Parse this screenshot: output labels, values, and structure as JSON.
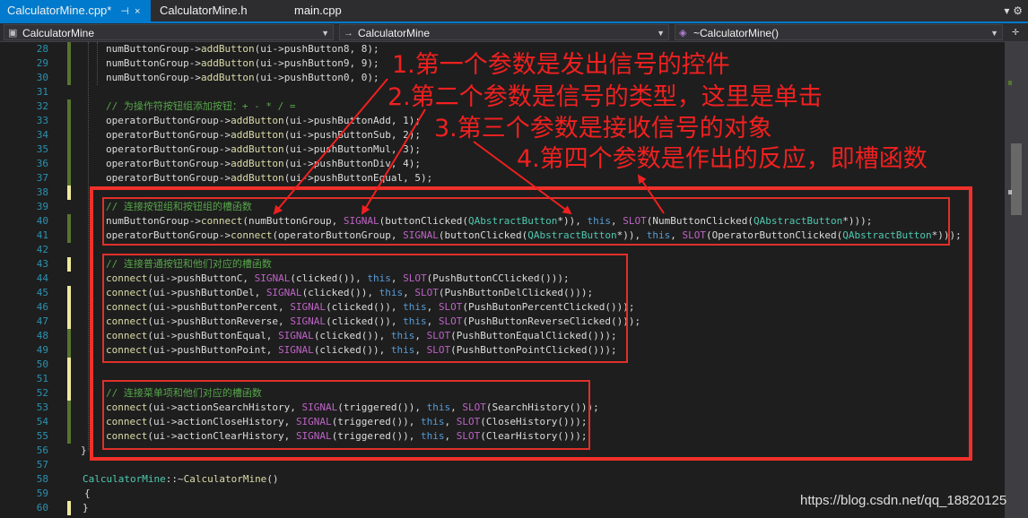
{
  "tabs": [
    {
      "label": "CalculatorMine.cpp*",
      "active": true,
      "pin": "⊣",
      "close": "×"
    },
    {
      "label": "CalculatorMine.h",
      "active": false
    },
    {
      "label": "main.cpp",
      "active": false
    }
  ],
  "tabbar_right_icons": "▾ ⚙",
  "nav": {
    "project": "CalculatorMine",
    "scope": "CalculatorMine",
    "member": "~CalculatorMine()"
  },
  "line_numbers": [
    "28",
    "29",
    "30",
    "31",
    "32",
    "33",
    "34",
    "35",
    "36",
    "37",
    "38",
    "39",
    "40",
    "41",
    "42",
    "43",
    "44",
    "45",
    "46",
    "47",
    "48",
    "49",
    "50",
    "51",
    "52",
    "53",
    "54",
    "55",
    "56",
    "57",
    "58",
    "59",
    "60"
  ],
  "annotations": [
    "1.第一个参数是发出信号的控件",
    "2.第二个参数是信号的类型，这里是单击",
    "3.第三个参数是接收信号的对象",
    "4.第四个参数是作出的反应，即槽函数"
  ],
  "watermark": "https://blog.csdn.net/qq_18820125",
  "colors": {
    "accent": "#007acc",
    "annotation": "#f02020",
    "comment": "#57a64a",
    "keyword": "#569cd6",
    "macro": "#bd63c5",
    "type": "#4ec9b0",
    "function": "#dcdcaa"
  }
}
